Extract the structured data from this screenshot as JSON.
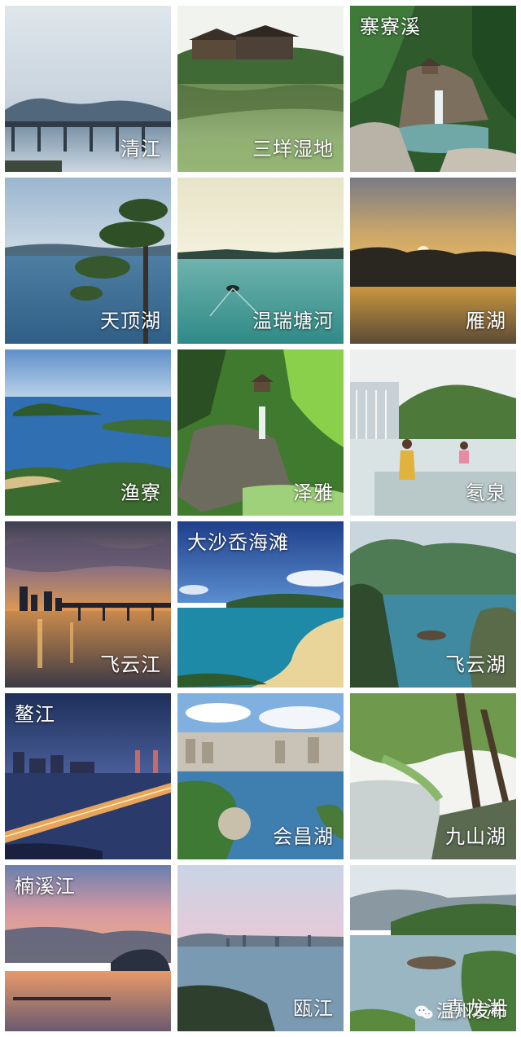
{
  "tiles": [
    {
      "name": "清江",
      "label_pos": "br"
    },
    {
      "name": "三垟湿地",
      "label_pos": "br"
    },
    {
      "name": "寨寮溪",
      "label_pos": "tl"
    },
    {
      "name": "天顶湖",
      "label_pos": "br"
    },
    {
      "name": "温瑞塘河",
      "label_pos": "br"
    },
    {
      "name": "雁湖",
      "label_pos": "br"
    },
    {
      "name": "渔寮",
      "label_pos": "br"
    },
    {
      "name": "泽雅",
      "label_pos": "br"
    },
    {
      "name": "氡泉",
      "label_pos": "br"
    },
    {
      "name": "飞云江",
      "label_pos": "br"
    },
    {
      "name": "大沙岙海滩",
      "label_pos": "tl"
    },
    {
      "name": "飞云湖",
      "label_pos": "br"
    },
    {
      "name": "鳌江",
      "label_pos": "tl"
    },
    {
      "name": "会昌湖",
      "label_pos": "br"
    },
    {
      "name": "九山湖",
      "label_pos": "br"
    },
    {
      "name": "楠溪江",
      "label_pos": "tl"
    },
    {
      "name": "瓯江",
      "label_pos": "br"
    },
    {
      "name": "青龙湖",
      "label_pos": "br"
    }
  ],
  "watermark": {
    "text": "温州发布",
    "icon": "wechat-icon"
  },
  "colors": {
    "label": "#ffffff",
    "background": "#ffffff"
  }
}
